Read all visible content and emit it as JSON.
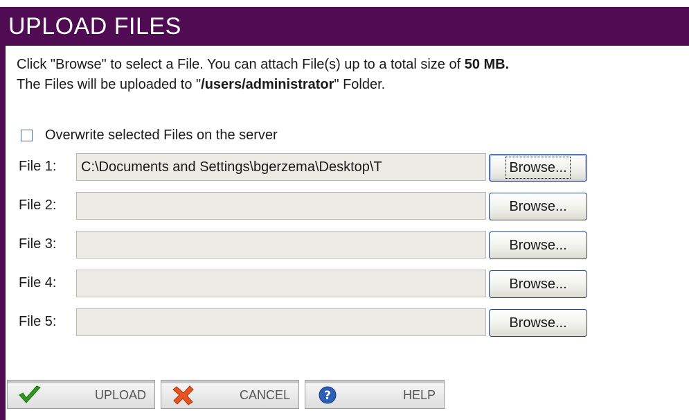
{
  "header": {
    "title": "UPLOAD FILES"
  },
  "description": {
    "line1_text": "Click \"Browse\" to select a File. You can attach File(s) up to a total size of ",
    "line1_size": "50 MB.",
    "line2_prefix": "The Files will be uploaded to \"",
    "line2_folder": "/users/administrator",
    "line2_suffix": "\" Folder."
  },
  "overwrite": {
    "label": "Overwrite selected Files on the server",
    "checked": false
  },
  "files": [
    {
      "label": "File 1:",
      "value": "C:\\Documents and Settings\\bgerzema\\Desktop\\T",
      "browse": "Browse..."
    },
    {
      "label": "File 2:",
      "value": "",
      "browse": "Browse..."
    },
    {
      "label": "File 3:",
      "value": "",
      "browse": "Browse..."
    },
    {
      "label": "File 4:",
      "value": "",
      "browse": "Browse..."
    },
    {
      "label": "File 5:",
      "value": "",
      "browse": "Browse..."
    }
  ],
  "actions": {
    "upload": "UPLOAD",
    "cancel": "CANCEL",
    "help": "HELP"
  },
  "colors": {
    "header": "#4f0c53",
    "upload_icon": "#2e9a1c",
    "cancel_icon": "#e8541e",
    "help_icon": "#2d5fb8"
  },
  "icons": {
    "upload": "checkmark-icon",
    "cancel": "x-icon",
    "help": "question-icon"
  }
}
